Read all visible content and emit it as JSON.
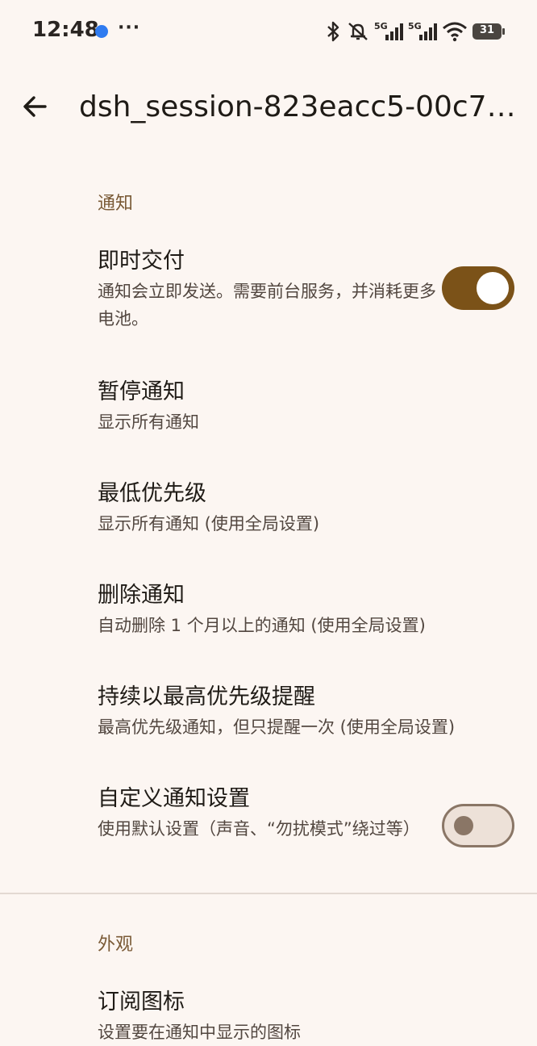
{
  "status_bar": {
    "time": "12:48",
    "more_indicator": "···",
    "icons": [
      "bluetooth-icon",
      "mute-vibrate-icon",
      "signal-5g-icon",
      "signal-5g-icon",
      "wifi-icon"
    ],
    "network_label": "5G",
    "battery": "31"
  },
  "app_bar": {
    "back_icon": "arrow-left-icon",
    "title": "dsh_session-823eacc5-00c7…"
  },
  "sections": {
    "notifications": {
      "header": "通知",
      "items": [
        {
          "title": "即时交付",
          "subtitle": "通知会立即发送。需要前台服务，并消耗更多电池。",
          "toggle": true
        },
        {
          "title": "暂停通知",
          "subtitle": "显示所有通知"
        },
        {
          "title": "最低优先级",
          "subtitle": "显示所有通知 (使用全局设置)"
        },
        {
          "title": "删除通知",
          "subtitle": "自动删除 1 个月以上的通知 (使用全局设置)"
        },
        {
          "title": "持续以最高优先级提醒",
          "subtitle": "最高优先级通知，但只提醒一次 (使用全局设置)"
        },
        {
          "title": "自定义通知设置",
          "subtitle": "使用默认设置（声音、“勿扰模式”绕过等）",
          "toggle": false
        }
      ]
    },
    "appearance": {
      "header": "外观",
      "items": [
        {
          "title": "订阅图标",
          "subtitle": "设置要在通知中显示的图标"
        }
      ]
    }
  },
  "colors": {
    "background": "#fcf6f2",
    "accent": "#7b5218",
    "section_header": "#7a5a36"
  }
}
